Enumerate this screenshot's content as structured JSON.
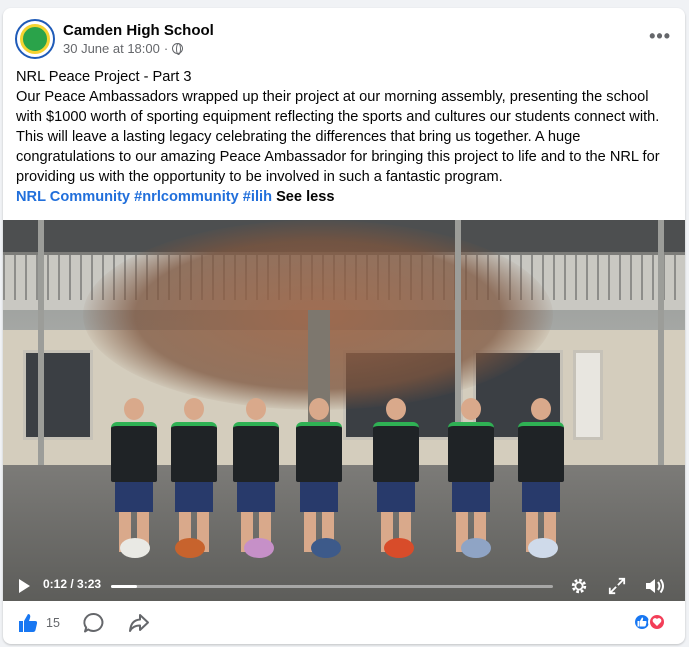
{
  "post": {
    "page_name": "Camden High School",
    "date": "30 June at 18:00",
    "separator": "·",
    "more_label": "•••",
    "title": "NRL Peace Project - Part 3",
    "body": "Our Peace Ambassadors wrapped up their project at our morning assembly, presenting the school with $1000 worth of sporting equipment reflecting the sports and cultures our students connect with. This will leave a lasting legacy celebrating the differences that bring us together. A huge congratulations to our amazing Peace Ambassador for bringing this project to life and to the NRL for providing us with the opportunity to be involved in such a fantastic program.",
    "hashtags": [
      "NRL Community",
      "#nrlcommunity",
      "#ilih"
    ],
    "see_less": "See less"
  },
  "video": {
    "current_time": "0:12",
    "duration": "3:23",
    "time_separator": " / ",
    "progress_fraction": 0.059
  },
  "footer": {
    "like_count": "15"
  },
  "colors": {
    "link": "#216fdb",
    "like_blue": "#1877f2",
    "love_red": "#f33e58",
    "jersey_green": "#2fb154"
  },
  "icons": [
    "globe-icon",
    "more-icon",
    "play-icon",
    "gear-icon",
    "expand-icon",
    "volume-icon",
    "like-icon",
    "comment-icon",
    "share-icon"
  ]
}
